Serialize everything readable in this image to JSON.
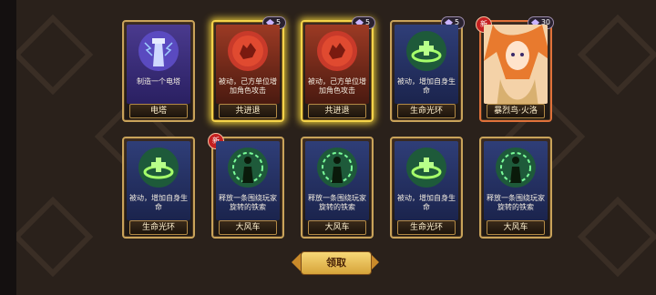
{
  "cards": [
    {
      "desc": "制造一个电塔",
      "title": "电塔",
      "cost": null,
      "is_new": false,
      "art": "tower-icon"
    },
    {
      "desc": "被动，己方单位增加角色攻击",
      "title": "共进退",
      "cost": "5",
      "is_new": false,
      "art": "red-fist-icon"
    },
    {
      "desc": "被动，己方单位增加角色攻击",
      "title": "共进退",
      "cost": "5",
      "is_new": false,
      "art": "red-fist-icon"
    },
    {
      "desc": "被动，增加自身生命",
      "title": "生命光环",
      "cost": "5",
      "is_new": false,
      "art": "heal-ring-icon"
    },
    {
      "desc": "",
      "title": "暴烈鸟·火洛",
      "cost": "30",
      "is_new": true,
      "art": "hero-portrait"
    },
    {
      "desc": "被动，增加自身生命",
      "title": "生命光环",
      "cost": null,
      "is_new": false,
      "art": "heal-ring-icon"
    },
    {
      "desc": "释放一条围绕玩家旋转的铁索",
      "title": "大风车",
      "cost": null,
      "is_new": true,
      "art": "spin-chain-icon"
    },
    {
      "desc": "释放一条围绕玩家旋转的铁索",
      "title": "大风车",
      "cost": null,
      "is_new": false,
      "art": "spin-chain-icon"
    },
    {
      "desc": "被动，增加自身生命",
      "title": "生命光环",
      "cost": null,
      "is_new": false,
      "art": "heal-ring-icon"
    },
    {
      "desc": "释放一条围绕玩家旋转的铁索",
      "title": "大风车",
      "cost": null,
      "is_new": false,
      "art": "spin-chain-icon"
    }
  ],
  "new_badge_label": "新",
  "claim_button_label": "领取",
  "colors": {
    "gold_glow": "#f4d34a",
    "card_border": "#c9a35a",
    "button": "#e8c05a"
  }
}
